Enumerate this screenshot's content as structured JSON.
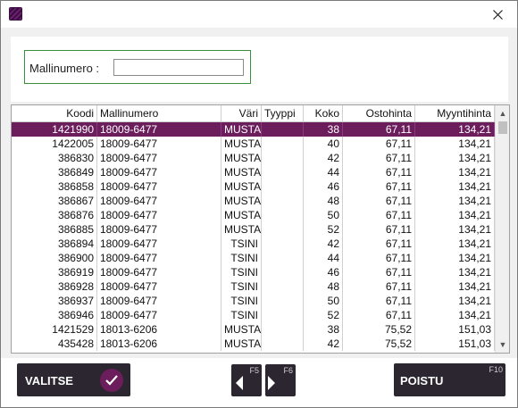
{
  "filter": {
    "label": "Mallinumero :",
    "value": "",
    "placeholder": ""
  },
  "grid": {
    "columns": [
      "Koodi",
      "Mallinumero",
      "Väri",
      "Tyyppi",
      "Koko",
      "Ostohinta",
      "Myyntihinta"
    ],
    "rows": [
      {
        "koodi": "1421990",
        "malli": "18009-6477",
        "vari": "MUSTA",
        "tyyppi": "",
        "koko": "38",
        "osto": "67,11",
        "myynti": "134,21"
      },
      {
        "koodi": "1422005",
        "malli": "18009-6477",
        "vari": "MUSTA",
        "tyyppi": "",
        "koko": "40",
        "osto": "67,11",
        "myynti": "134,21"
      },
      {
        "koodi": "386830",
        "malli": "18009-6477",
        "vari": "MUSTA",
        "tyyppi": "",
        "koko": "42",
        "osto": "67,11",
        "myynti": "134,21"
      },
      {
        "koodi": "386849",
        "malli": "18009-6477",
        "vari": "MUSTA",
        "tyyppi": "",
        "koko": "44",
        "osto": "67,11",
        "myynti": "134,21"
      },
      {
        "koodi": "386858",
        "malli": "18009-6477",
        "vari": "MUSTA",
        "tyyppi": "",
        "koko": "46",
        "osto": "67,11",
        "myynti": "134,21"
      },
      {
        "koodi": "386867",
        "malli": "18009-6477",
        "vari": "MUSTA",
        "tyyppi": "",
        "koko": "48",
        "osto": "67,11",
        "myynti": "134,21"
      },
      {
        "koodi": "386876",
        "malli": "18009-6477",
        "vari": "MUSTA",
        "tyyppi": "",
        "koko": "50",
        "osto": "67,11",
        "myynti": "134,21"
      },
      {
        "koodi": "386885",
        "malli": "18009-6477",
        "vari": "MUSTA",
        "tyyppi": "",
        "koko": "52",
        "osto": "67,11",
        "myynti": "134,21"
      },
      {
        "koodi": "386894",
        "malli": "18009-6477",
        "vari": "TSINI",
        "tyyppi": "",
        "koko": "42",
        "osto": "67,11",
        "myynti": "134,21"
      },
      {
        "koodi": "386900",
        "malli": "18009-6477",
        "vari": "TSINI",
        "tyyppi": "",
        "koko": "44",
        "osto": "67,11",
        "myynti": "134,21"
      },
      {
        "koodi": "386919",
        "malli": "18009-6477",
        "vari": "TSINI",
        "tyyppi": "",
        "koko": "46",
        "osto": "67,11",
        "myynti": "134,21"
      },
      {
        "koodi": "386928",
        "malli": "18009-6477",
        "vari": "TSINI",
        "tyyppi": "",
        "koko": "48",
        "osto": "67,11",
        "myynti": "134,21"
      },
      {
        "koodi": "386937",
        "malli": "18009-6477",
        "vari": "TSINI",
        "tyyppi": "",
        "koko": "50",
        "osto": "67,11",
        "myynti": "134,21"
      },
      {
        "koodi": "386946",
        "malli": "18009-6477",
        "vari": "TSINI",
        "tyyppi": "",
        "koko": "52",
        "osto": "67,11",
        "myynti": "134,21"
      },
      {
        "koodi": "1421529",
        "malli": "18013-6206",
        "vari": "MUSTA",
        "tyyppi": "",
        "koko": "38",
        "osto": "75,52",
        "myynti": "151,03"
      },
      {
        "koodi": "435428",
        "malli": "18013-6206",
        "vari": "MUSTA",
        "tyyppi": "",
        "koko": "42",
        "osto": "75,52",
        "myynti": "151,03"
      }
    ],
    "selected_index": 0
  },
  "footer": {
    "select_label": "VALITSE",
    "prev_key": "F5",
    "next_key": "F6",
    "exit_label": "POISTU",
    "exit_key": "F10"
  },
  "colors": {
    "accent": "#6b1d5c",
    "button_dark": "#2b2630",
    "filter_border": "#3a8f3a"
  }
}
